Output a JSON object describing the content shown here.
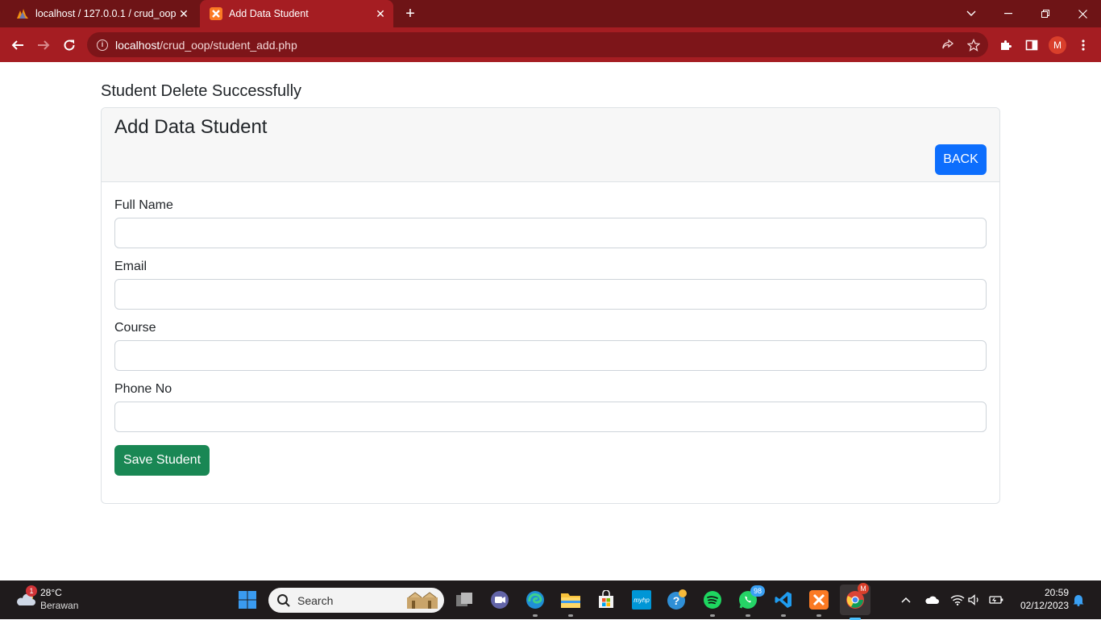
{
  "browser": {
    "tabs": [
      {
        "title": "localhost / 127.0.0.1 / crud_oop / ...",
        "active": false
      },
      {
        "title": "Add Data Student",
        "active": true
      }
    ],
    "url_host": "localhost",
    "url_path": "/crud_oop/student_add.php",
    "profile_initial": "M"
  },
  "page": {
    "message": "Student Delete Successfully",
    "card_title": "Add Data Student",
    "back_label": "BACK",
    "fields": [
      {
        "label": "Full Name",
        "value": ""
      },
      {
        "label": "Email",
        "value": ""
      },
      {
        "label": "Course",
        "value": ""
      },
      {
        "label": "Phone No",
        "value": ""
      }
    ],
    "save_label": "Save Student"
  },
  "taskbar": {
    "weather_temp": "28°C",
    "weather_cond": "Berawan",
    "weather_badge": "1",
    "search_label": "Search",
    "whatsapp_badge": "98",
    "chrome_badge": "M",
    "time": "20:59",
    "date": "02/12/2023"
  },
  "colors": {
    "tabbar": "#6e1416",
    "toolbar": "#a51d22",
    "primary": "#0d6efd",
    "success": "#198754"
  }
}
